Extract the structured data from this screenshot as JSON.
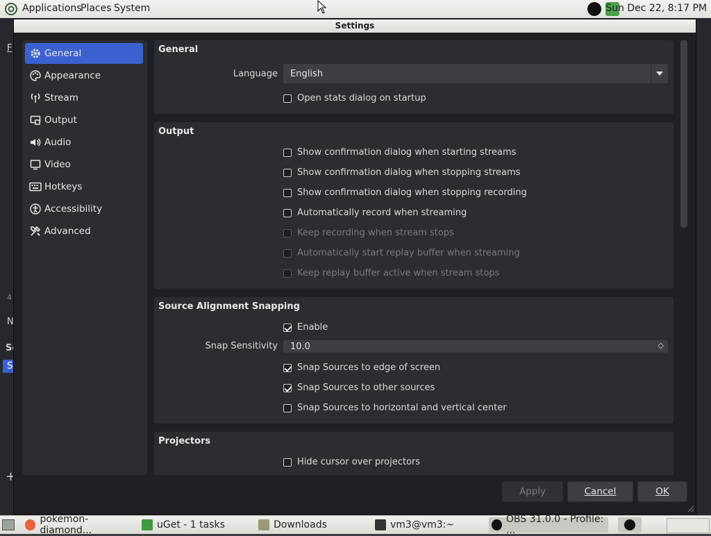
{
  "top_panel": {
    "menus": [
      "Applications",
      "Places",
      "System"
    ],
    "clock": "Sun Dec 22,  8:17 PM"
  },
  "background": {
    "fragments": [
      "F",
      "4",
      "N",
      "Sc",
      "S"
    ]
  },
  "dialog": {
    "title": "Settings",
    "sidebar": [
      {
        "label": "General",
        "icon": "gear-icon",
        "active": true
      },
      {
        "label": "Appearance",
        "icon": "palette-icon"
      },
      {
        "label": "Stream",
        "icon": "antenna-icon"
      },
      {
        "label": "Output",
        "icon": "output-icon"
      },
      {
        "label": "Audio",
        "icon": "speaker-icon"
      },
      {
        "label": "Video",
        "icon": "monitor-icon"
      },
      {
        "label": "Hotkeys",
        "icon": "keyboard-icon"
      },
      {
        "label": "Accessibility",
        "icon": "accessibility-icon"
      },
      {
        "label": "Advanced",
        "icon": "tools-icon"
      }
    ],
    "general": {
      "title": "General",
      "language_label": "Language",
      "language_value": "English",
      "open_stats": "Open stats dialog on startup"
    },
    "output": {
      "title": "Output",
      "options": [
        {
          "label": "Show confirmation dialog when starting streams",
          "checked": false,
          "disabled": false
        },
        {
          "label": "Show confirmation dialog when stopping streams",
          "checked": false,
          "disabled": false
        },
        {
          "label": "Show confirmation dialog when stopping recording",
          "checked": false,
          "disabled": false
        },
        {
          "label": "Automatically record when streaming",
          "checked": false,
          "disabled": false
        },
        {
          "label": "Keep recording when stream stops",
          "checked": false,
          "disabled": true
        },
        {
          "label": "Automatically start replay buffer when streaming",
          "checked": false,
          "disabled": true
        },
        {
          "label": "Keep replay buffer active when stream stops",
          "checked": false,
          "disabled": true
        }
      ]
    },
    "snapping": {
      "title": "Source Alignment Snapping",
      "enable": "Enable",
      "sensitivity_label": "Snap Sensitivity",
      "sensitivity_value": "10.0",
      "opt_edge": "Snap Sources to edge of screen",
      "opt_other": "Snap Sources to other sources",
      "opt_center": "Snap Sources to horizontal and vertical center"
    },
    "projectors": {
      "title": "Projectors",
      "hide_cursor": "Hide cursor over projectors"
    },
    "buttons": {
      "apply": "Apply",
      "cancel": "Cancel",
      "ok": "OK"
    }
  },
  "taskbar": {
    "tasks": [
      "pokemon-diamond...",
      "uGet - 1 tasks",
      "Downloads",
      "vm3@vm3:~",
      "OBS 31.0.0 - Profile: ..."
    ]
  },
  "colors": {
    "accent": "#3b61d0",
    "dialog_bg": "#1f2024",
    "panel_bg": "#2b2d31"
  }
}
